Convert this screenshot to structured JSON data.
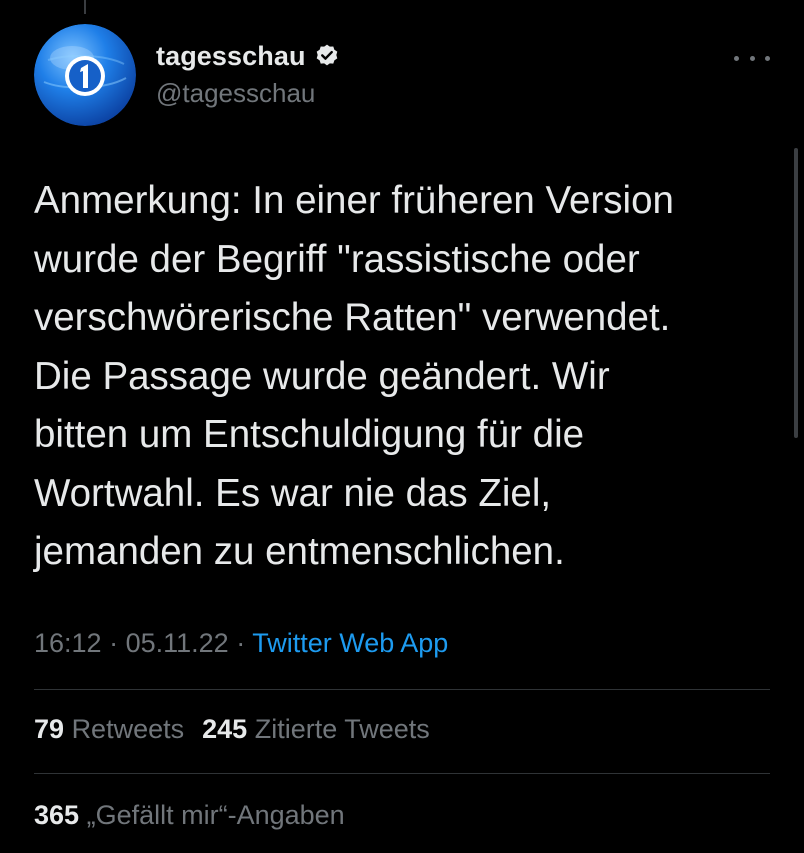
{
  "author": {
    "display_name": "tagesschau",
    "handle": "@tagesschau",
    "verified": true,
    "avatar_icon": "tagesschau-logo-icon",
    "avatar_color": "#1a6fd6"
  },
  "tweet": {
    "text": "Anmerkung: In einer früheren Version\nwurde der Begriff \"rassistische oder\nverschwörerische Ratten\" verwendet.\nDie Passage wurde geändert. Wir\nbitten um Entschuldigung für die\nWortwahl. Es war nie das Ziel,\njemanden zu entmenschlichen.",
    "time": "16:12",
    "date": "05.11.22",
    "separator": " · ",
    "source": "Twitter Web App"
  },
  "stats": {
    "retweets_count": "79",
    "retweets_label": "Retweets",
    "quotes_count": "245",
    "quotes_label": "Zitierte Tweets",
    "likes_count": "365",
    "likes_label": "„Gefällt mir“-Angaben"
  },
  "colors": {
    "background": "#000000",
    "text_primary": "#e7e9ea",
    "text_secondary": "#71767b",
    "link": "#1d9bf0",
    "divider": "#2f3336"
  }
}
